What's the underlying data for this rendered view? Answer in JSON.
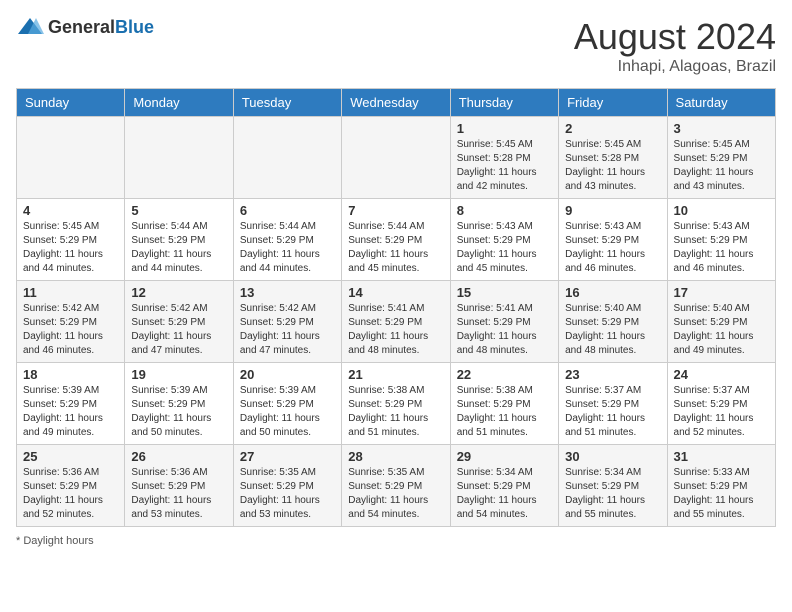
{
  "header": {
    "logo_general": "General",
    "logo_blue": "Blue",
    "main_title": "August 2024",
    "subtitle": "Inhapi, Alagoas, Brazil"
  },
  "days_of_week": [
    "Sunday",
    "Monday",
    "Tuesday",
    "Wednesday",
    "Thursday",
    "Friday",
    "Saturday"
  ],
  "weeks": [
    [
      {
        "day": "",
        "info": ""
      },
      {
        "day": "",
        "info": ""
      },
      {
        "day": "",
        "info": ""
      },
      {
        "day": "",
        "info": ""
      },
      {
        "day": "1",
        "info": "Sunrise: 5:45 AM\nSunset: 5:28 PM\nDaylight: 11 hours and 42 minutes."
      },
      {
        "day": "2",
        "info": "Sunrise: 5:45 AM\nSunset: 5:28 PM\nDaylight: 11 hours and 43 minutes."
      },
      {
        "day": "3",
        "info": "Sunrise: 5:45 AM\nSunset: 5:29 PM\nDaylight: 11 hours and 43 minutes."
      }
    ],
    [
      {
        "day": "4",
        "info": "Sunrise: 5:45 AM\nSunset: 5:29 PM\nDaylight: 11 hours and 44 minutes."
      },
      {
        "day": "5",
        "info": "Sunrise: 5:44 AM\nSunset: 5:29 PM\nDaylight: 11 hours and 44 minutes."
      },
      {
        "day": "6",
        "info": "Sunrise: 5:44 AM\nSunset: 5:29 PM\nDaylight: 11 hours and 44 minutes."
      },
      {
        "day": "7",
        "info": "Sunrise: 5:44 AM\nSunset: 5:29 PM\nDaylight: 11 hours and 45 minutes."
      },
      {
        "day": "8",
        "info": "Sunrise: 5:43 AM\nSunset: 5:29 PM\nDaylight: 11 hours and 45 minutes."
      },
      {
        "day": "9",
        "info": "Sunrise: 5:43 AM\nSunset: 5:29 PM\nDaylight: 11 hours and 46 minutes."
      },
      {
        "day": "10",
        "info": "Sunrise: 5:43 AM\nSunset: 5:29 PM\nDaylight: 11 hours and 46 minutes."
      }
    ],
    [
      {
        "day": "11",
        "info": "Sunrise: 5:42 AM\nSunset: 5:29 PM\nDaylight: 11 hours and 46 minutes."
      },
      {
        "day": "12",
        "info": "Sunrise: 5:42 AM\nSunset: 5:29 PM\nDaylight: 11 hours and 47 minutes."
      },
      {
        "day": "13",
        "info": "Sunrise: 5:42 AM\nSunset: 5:29 PM\nDaylight: 11 hours and 47 minutes."
      },
      {
        "day": "14",
        "info": "Sunrise: 5:41 AM\nSunset: 5:29 PM\nDaylight: 11 hours and 48 minutes."
      },
      {
        "day": "15",
        "info": "Sunrise: 5:41 AM\nSunset: 5:29 PM\nDaylight: 11 hours and 48 minutes."
      },
      {
        "day": "16",
        "info": "Sunrise: 5:40 AM\nSunset: 5:29 PM\nDaylight: 11 hours and 48 minutes."
      },
      {
        "day": "17",
        "info": "Sunrise: 5:40 AM\nSunset: 5:29 PM\nDaylight: 11 hours and 49 minutes."
      }
    ],
    [
      {
        "day": "18",
        "info": "Sunrise: 5:39 AM\nSunset: 5:29 PM\nDaylight: 11 hours and 49 minutes."
      },
      {
        "day": "19",
        "info": "Sunrise: 5:39 AM\nSunset: 5:29 PM\nDaylight: 11 hours and 50 minutes."
      },
      {
        "day": "20",
        "info": "Sunrise: 5:39 AM\nSunset: 5:29 PM\nDaylight: 11 hours and 50 minutes."
      },
      {
        "day": "21",
        "info": "Sunrise: 5:38 AM\nSunset: 5:29 PM\nDaylight: 11 hours and 51 minutes."
      },
      {
        "day": "22",
        "info": "Sunrise: 5:38 AM\nSunset: 5:29 PM\nDaylight: 11 hours and 51 minutes."
      },
      {
        "day": "23",
        "info": "Sunrise: 5:37 AM\nSunset: 5:29 PM\nDaylight: 11 hours and 51 minutes."
      },
      {
        "day": "24",
        "info": "Sunrise: 5:37 AM\nSunset: 5:29 PM\nDaylight: 11 hours and 52 minutes."
      }
    ],
    [
      {
        "day": "25",
        "info": "Sunrise: 5:36 AM\nSunset: 5:29 PM\nDaylight: 11 hours and 52 minutes."
      },
      {
        "day": "26",
        "info": "Sunrise: 5:36 AM\nSunset: 5:29 PM\nDaylight: 11 hours and 53 minutes."
      },
      {
        "day": "27",
        "info": "Sunrise: 5:35 AM\nSunset: 5:29 PM\nDaylight: 11 hours and 53 minutes."
      },
      {
        "day": "28",
        "info": "Sunrise: 5:35 AM\nSunset: 5:29 PM\nDaylight: 11 hours and 54 minutes."
      },
      {
        "day": "29",
        "info": "Sunrise: 5:34 AM\nSunset: 5:29 PM\nDaylight: 11 hours and 54 minutes."
      },
      {
        "day": "30",
        "info": "Sunrise: 5:34 AM\nSunset: 5:29 PM\nDaylight: 11 hours and 55 minutes."
      },
      {
        "day": "31",
        "info": "Sunrise: 5:33 AM\nSunset: 5:29 PM\nDaylight: 11 hours and 55 minutes."
      }
    ]
  ],
  "footer": {
    "daylight_hours_label": "Daylight hours"
  }
}
